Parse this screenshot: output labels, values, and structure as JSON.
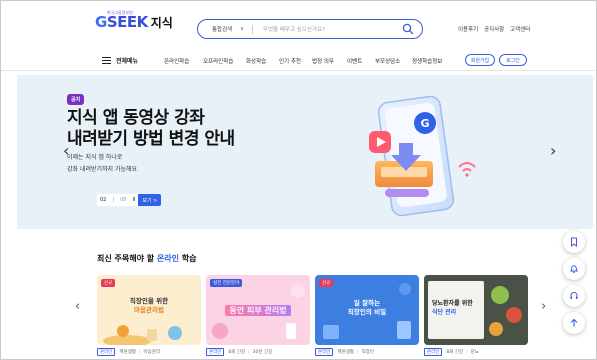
{
  "header": {
    "logo_small": "한국고용정보원",
    "logo_brand_g": "G",
    "logo_brand_rest": "SEEK",
    "logo_sub": "지식",
    "search_select": "통합검색",
    "search_placeholder": "무엇을 배우고 싶으신가요?",
    "util_links": [
      "이용후기",
      "공지사항",
      "고객센터"
    ]
  },
  "nav": {
    "all_menu": "전체메뉴",
    "items": [
      "온라인학습",
      "오프라인학습",
      "화상학습",
      "인기 추천",
      "법정 의무",
      "이벤트",
      "부모상담소",
      "정생학습정보"
    ],
    "signup": "회원가입",
    "login": "로그인"
  },
  "hero": {
    "badge": "공지",
    "title_line1": "지식 앱 동영상 강좌",
    "title_line2": "내려받기 방법 변경 안내",
    "desc_line1": "이제는 지식 앱 하나로",
    "desc_line2": "강좌 내려받기까지 가능해요",
    "page_current": "02",
    "page_total": "08",
    "pause": "II",
    "more": "보기 >",
    "prev": "‹",
    "next": "›"
  },
  "section": {
    "title_pre": "최신 주목해야 할 ",
    "title_hl": "온라인",
    "title_post": " 학습",
    "prev": "‹",
    "next": "›"
  },
  "cards": [
    {
      "tag": "신규",
      "line1": "직장인을 위한",
      "line2": "마음관리법",
      "meta_tag": "온라인",
      "meta_a": "핵원생활",
      "meta_b": "마음관리"
    },
    {
      "tag": "실전 전문분야",
      "line1": "동안 피부 관리법",
      "line2": "",
      "meta_tag": "온라인",
      "meta_a": "8회 긴강",
      "meta_b": "30분 긴강"
    },
    {
      "tag": "신규",
      "line1": "일 잘하는",
      "line2": "직장인의 비밀",
      "meta_tag": "온라인",
      "meta_a": "핵원생활",
      "meta_b": "직장인"
    },
    {
      "tag": "",
      "line1": "당뇨환자를 위한",
      "line2": "식단 관리",
      "meta_tag": "온라인",
      "meta_a": "8회 긴강",
      "meta_b": "당뇨"
    }
  ],
  "floating": [
    "bookmark-icon",
    "bell-icon",
    "headset-icon",
    "arrow-up-icon"
  ]
}
